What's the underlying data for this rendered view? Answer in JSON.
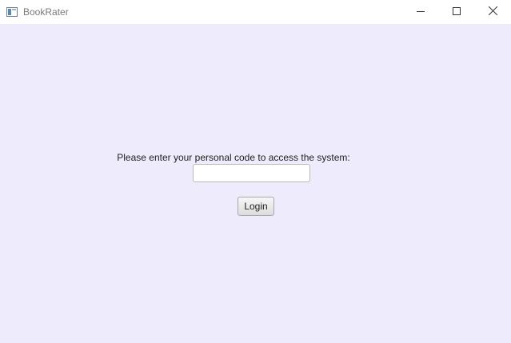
{
  "window": {
    "title": "BookRater",
    "icons": {
      "app": "app-window-icon",
      "minimize": "minimize-icon",
      "maximize": "maximize-icon",
      "close": "close-icon"
    }
  },
  "login": {
    "prompt": "Please enter your personal code to access the system:",
    "code_value": "",
    "button_label": "Login"
  },
  "colors": {
    "content_background": "#edebfc",
    "titlebar_background": "#ffffff",
    "title_text": "#7a7a7a"
  }
}
